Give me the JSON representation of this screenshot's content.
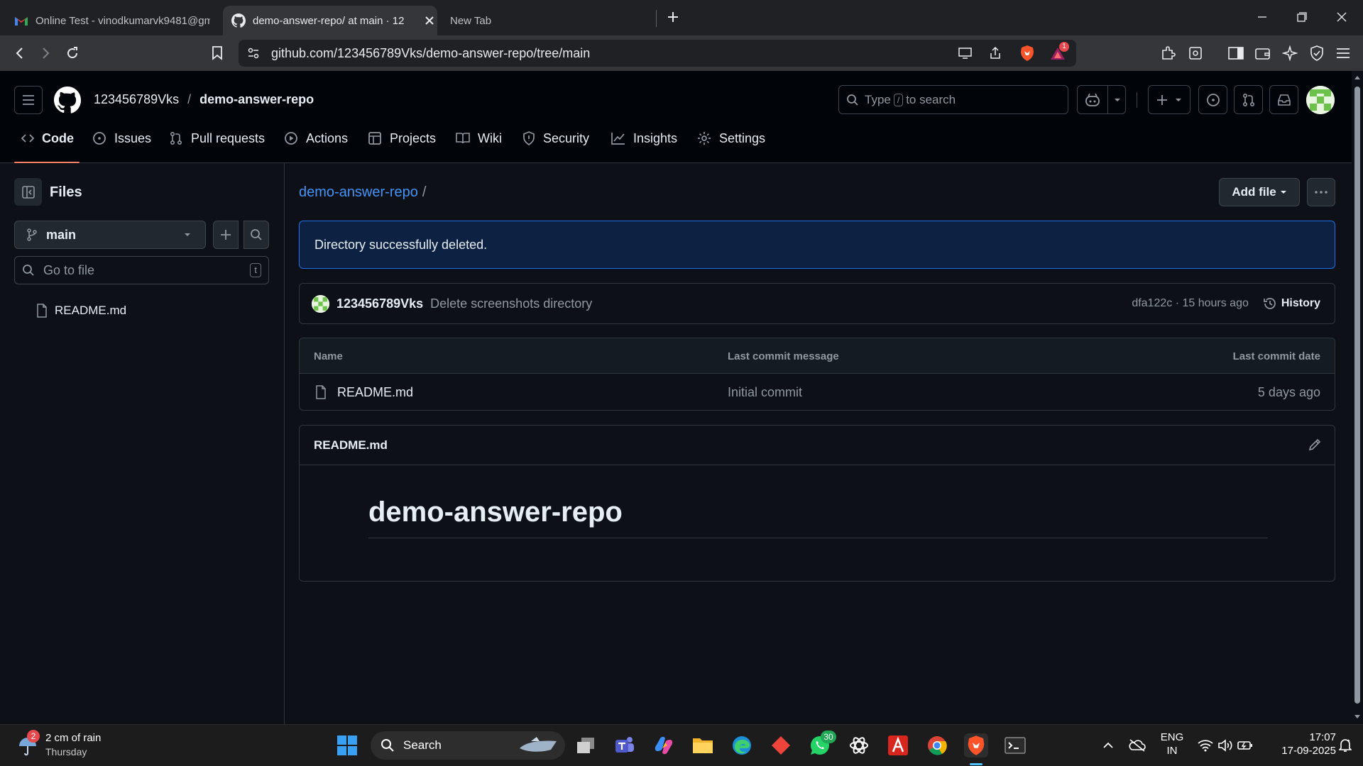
{
  "browser": {
    "tabs": [
      {
        "title": "Online Test - vinodkumarvk9481@gm",
        "icon": "gmail-icon"
      },
      {
        "title": "demo-answer-repo/ at main · 12",
        "icon": "github-icon",
        "active": true
      },
      {
        "title": "New Tab",
        "icon": "none"
      }
    ],
    "url": "github.com/123456789Vks/demo-answer-repo/tree/main",
    "brave_badge": "1"
  },
  "header": {
    "owner": "123456789Vks",
    "separator": "/",
    "repo": "demo-answer-repo",
    "search_prefix": "Type",
    "search_key": "/",
    "search_suffix": "to search"
  },
  "nav": {
    "items": [
      {
        "label": "Code",
        "icon": "code-icon",
        "selected": true
      },
      {
        "label": "Issues",
        "icon": "issue-icon"
      },
      {
        "label": "Pull requests",
        "icon": "pull-request-icon"
      },
      {
        "label": "Actions",
        "icon": "play-icon"
      },
      {
        "label": "Projects",
        "icon": "table-icon"
      },
      {
        "label": "Wiki",
        "icon": "book-icon"
      },
      {
        "label": "Security",
        "icon": "shield-icon"
      },
      {
        "label": "Insights",
        "icon": "graph-icon"
      },
      {
        "label": "Settings",
        "icon": "gear-icon"
      }
    ]
  },
  "sidebar": {
    "title": "Files",
    "branch": "main",
    "go_to_file_placeholder": "Go to file",
    "shortcut": "t",
    "files": [
      {
        "name": "README.md"
      }
    ]
  },
  "main": {
    "breadcrumb_repo": "demo-answer-repo",
    "breadcrumb_sep": "/",
    "add_file_label": "Add file",
    "flash_message": "Directory successfully deleted.",
    "commit": {
      "author": "123456789Vks",
      "message": "Delete screenshots directory",
      "meta": "dfa122c · 15 hours ago",
      "history_label": "History"
    },
    "table": {
      "headers": [
        "Name",
        "Last commit message",
        "Last commit date"
      ],
      "rows": [
        {
          "name": "README.md",
          "message": "Initial commit",
          "date": "5 days ago"
        }
      ]
    },
    "readme": {
      "filename": "README.md",
      "heading": "demo-answer-repo"
    }
  },
  "taskbar": {
    "weather_badge": "2",
    "weather_title": "2 cm of rain",
    "weather_sub": "Thursday",
    "search_label": "Search",
    "whatsapp_badge": "30",
    "lang_top": "ENG",
    "lang_bottom": "IN",
    "time": "17:07",
    "date": "17-09-2025"
  },
  "colors": {
    "accent_link": "#4493f8",
    "flash_bg": "#0d2142",
    "flash_border": "#1f6feb",
    "nav_underline": "#f78166"
  }
}
